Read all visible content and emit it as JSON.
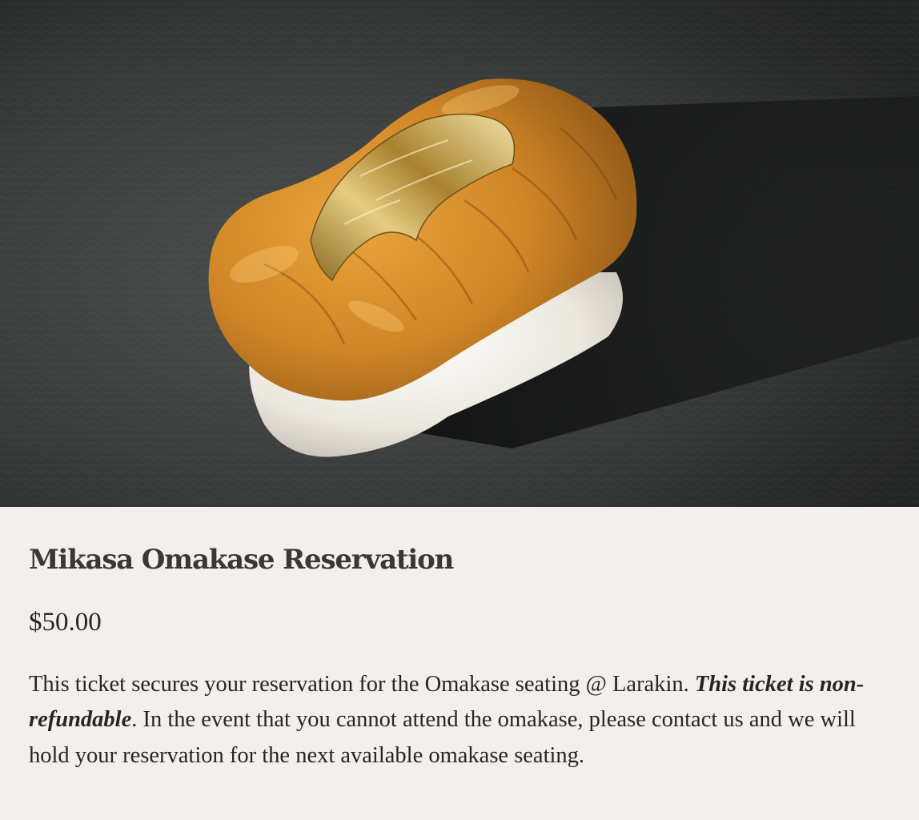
{
  "hero": {
    "alt": "Uni nigiri topped with gold leaf on a slate plate"
  },
  "product": {
    "title": "Mikasa Omakase Reservation",
    "price": "$50.00",
    "description": {
      "part1": "This ticket secures your reservation for the Omakase seating @ Larakin. ",
      "emphasis": "This ticket is non-refundable",
      "part2": ". In the event that you cannot attend the omakase, please contact us and we will hold your reservation for the next available omakase seating."
    }
  },
  "colors": {
    "background": "#f3efed",
    "title": "#3d3536",
    "text": "#2a2426",
    "slate": "#2b2e2d",
    "uni": "#d08a2a",
    "rice": "#f4f1ea",
    "gold_leaf": "#c9a24a"
  }
}
